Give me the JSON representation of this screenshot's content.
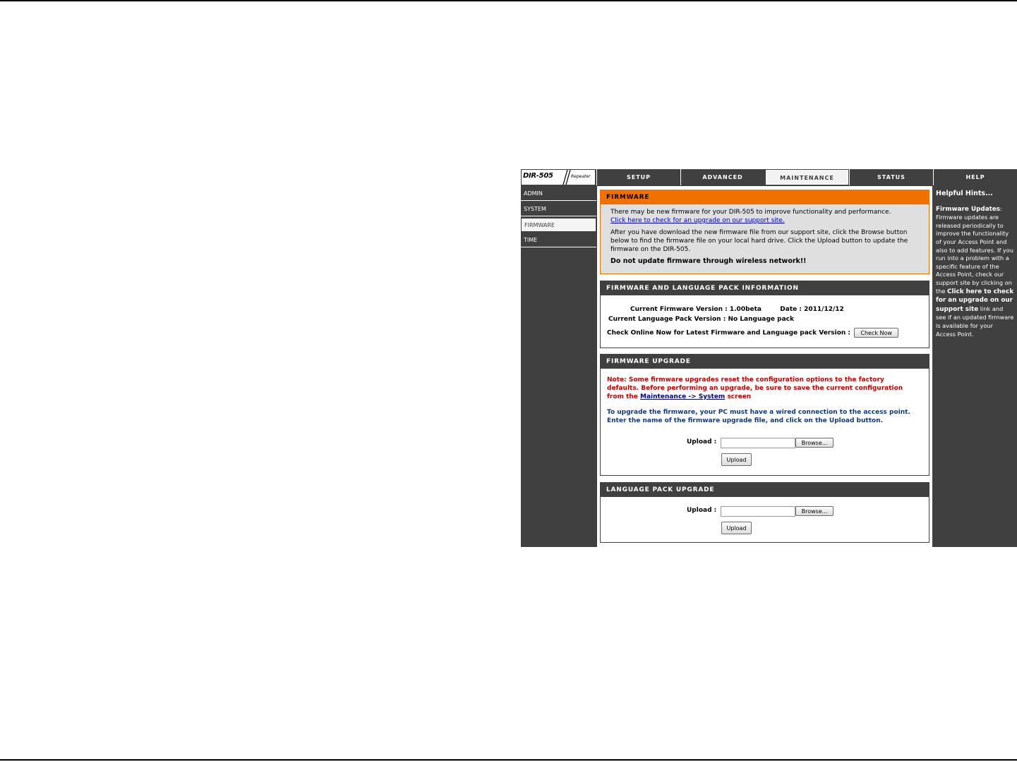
{
  "header": {
    "model": "DIR-505",
    "subtitle": "Repeater",
    "tabs": [
      {
        "label": "SETUP"
      },
      {
        "label": "ADVANCED"
      },
      {
        "label": "MAINTENANCE"
      },
      {
        "label": "STATUS"
      },
      {
        "label": "HELP"
      }
    ],
    "active_tab": "MAINTENANCE"
  },
  "sidebar": {
    "items": [
      {
        "label": "ADMIN"
      },
      {
        "label": "SYSTEM"
      },
      {
        "label": "FIRMWARE"
      },
      {
        "label": "TIME"
      }
    ],
    "active_item": "FIRMWARE"
  },
  "firmware": {
    "title": "FIRMWARE",
    "intro": "There may be new firmware for your DIR-505 to improve functionality and performance.",
    "support_link": "Click here to check for an upgrade on our support site.",
    "instructions": "After you have download the new firmware file from our support site, click the Browse button below to find the firmware file on your local hard drive. Click the Upload button to update the firmware on the DIR-505.",
    "warning": "Do not update firmware through wireless network!!"
  },
  "info": {
    "title": "FIRMWARE AND LANGUAGE PACK INFORMATION",
    "firmware_version_label": "Current Firmware Version :",
    "firmware_version": "1.00beta",
    "date_label": "Date :",
    "date": "2011/12/12",
    "language_pack_label": "Current Language Pack Version :",
    "language_pack": "No Language pack",
    "check_label": "Check Online Now for Latest Firmware and Language pack Version :",
    "check_button": "Check Now"
  },
  "firmware_upgrade": {
    "title": "FIRMWARE UPGRADE",
    "note_part1": "Note: Some firmware upgrades reset the configuration options to the factory defaults. Before performing an upgrade, be sure to save the current configuration from the",
    "note_link": "Maintenance -> System",
    "note_part2": "screen",
    "info_line1": "To upgrade the firmware, your PC must have a wired connection to the access point.",
    "info_line2": "Enter the name of the firmware upgrade file, and click on the Upload button.",
    "upload_label": "Upload :",
    "upload_value": "",
    "browse_button": "Browse...",
    "upload_button": "Upload"
  },
  "language_upgrade": {
    "title": "LANGUAGE PACK UPGRADE",
    "upload_label": "Upload :",
    "upload_value": "",
    "browse_button": "Browse...",
    "upload_button": "Upload"
  },
  "help": {
    "title": "Helpful Hints...",
    "heading": "Firmware Updates",
    "text1": ": Firmware updates are released periodically to improve the functionality of your Access Point and also to add features. If you run into a problem with a specific feature of the Access Point, check our support site by clicking on the",
    "bold_text": "Click here to check for an upgrade on our support site",
    "text2": "link and see if an updated firmware is available for your Access Point."
  },
  "colors": {
    "accent": "#f07000",
    "panel": "#404040",
    "note_red": "#cc0000",
    "info_navy": "#14387f",
    "link_blue": "#0000cc"
  }
}
